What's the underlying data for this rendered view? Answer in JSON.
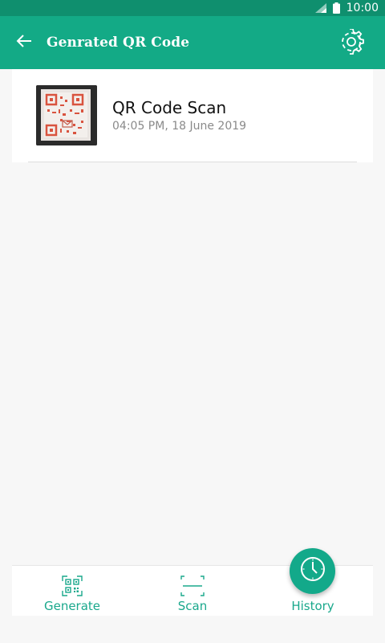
{
  "status_bar": {
    "time": "10:00",
    "icons": [
      "signal-icon",
      "battery-icon"
    ]
  },
  "app_bar": {
    "title": "Genrated QR Code",
    "back_icon": "arrow-left-icon",
    "settings_icon": "gear-icon",
    "color": "#13aa86"
  },
  "history": {
    "items": [
      {
        "title": "QR Code Scan",
        "subtitle": "04:05 PM, 18 June 2019",
        "thumbnail": "qr-code-photo"
      }
    ]
  },
  "bottom_nav": {
    "accent": "#1aa88c",
    "items": [
      {
        "label": "Generate",
        "icon": "qr-generate-icon"
      },
      {
        "label": "Scan",
        "icon": "scan-frame-icon"
      },
      {
        "label": "History",
        "icon": "clock-icon"
      }
    ]
  }
}
